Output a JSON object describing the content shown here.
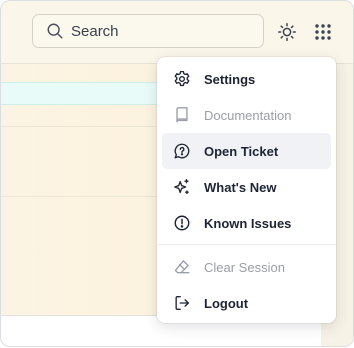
{
  "search": {
    "placeholder": "Search",
    "icon": "search-icon"
  },
  "toolbar": {
    "theme_icon": "sun-icon",
    "apps_icon": "grid-icon"
  },
  "menu": {
    "items": [
      {
        "label": "Settings",
        "icon": "gear-icon",
        "state": "normal"
      },
      {
        "label": "Documentation",
        "icon": "book-icon",
        "state": "disabled"
      },
      {
        "label": "Open Ticket",
        "icon": "help-ticket-icon",
        "state": "hover"
      },
      {
        "label": "What's New",
        "icon": "sparkles-icon",
        "state": "normal"
      },
      {
        "label": "Known Issues",
        "icon": "alert-circle-icon",
        "state": "normal"
      }
    ],
    "items_after_separator": [
      {
        "label": "Clear Session",
        "icon": "eraser-icon",
        "state": "disabled"
      },
      {
        "label": "Logout",
        "icon": "logout-icon",
        "state": "normal"
      }
    ]
  },
  "colors": {
    "text_primary": "#1d2433",
    "text_disabled": "#9a9ea8",
    "hover_bg": "#f1f2f5",
    "topbar_bg": "#faf6ea",
    "highlight_row": "#e9fbf8"
  }
}
